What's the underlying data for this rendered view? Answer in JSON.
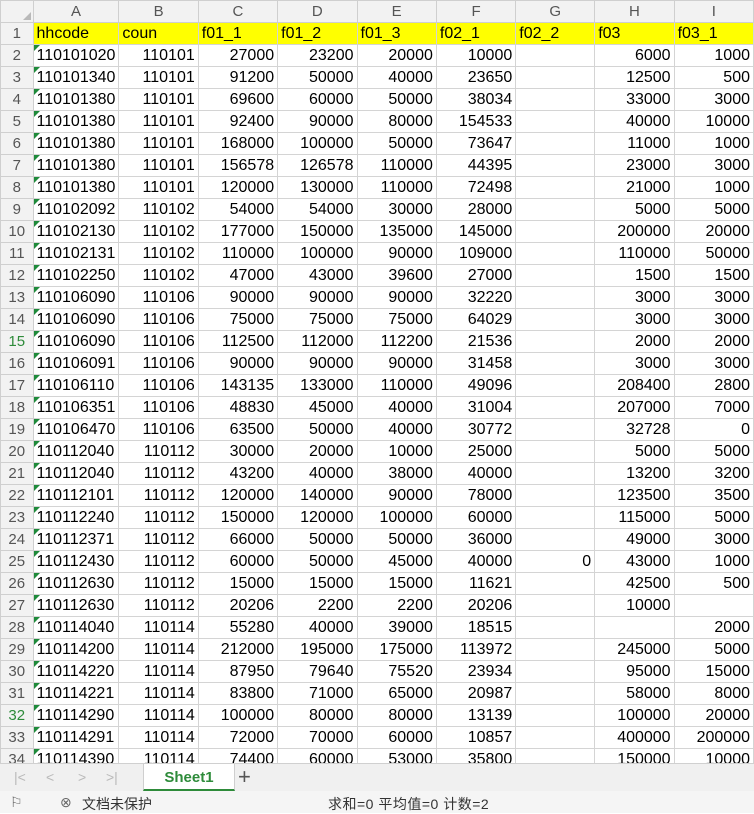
{
  "colors": {
    "header_fill": "#ffff00",
    "accent": "#2e8b3a",
    "grid": "#d4d4d4"
  },
  "columns": [
    "A",
    "B",
    "C",
    "D",
    "E",
    "F",
    "G",
    "H",
    "I"
  ],
  "selected_rows": [
    "15",
    "32"
  ],
  "header_row": {
    "num": "1",
    "cells": [
      "hhcode",
      "coun",
      "f01_1",
      "f01_2",
      "f01_3",
      "f02_1",
      "f02_2",
      "f03",
      "f03_1"
    ]
  },
  "rows": [
    {
      "num": "2",
      "cells": [
        "110101020",
        "110101",
        "27000",
        "23200",
        "20000",
        "10000",
        "",
        "6000",
        "1000"
      ]
    },
    {
      "num": "3",
      "cells": [
        "110101340",
        "110101",
        "91200",
        "50000",
        "40000",
        "23650",
        "",
        "12500",
        "500"
      ]
    },
    {
      "num": "4",
      "cells": [
        "110101380",
        "110101",
        "69600",
        "60000",
        "50000",
        "38034",
        "",
        "33000",
        "3000"
      ]
    },
    {
      "num": "5",
      "cells": [
        "110101380",
        "110101",
        "92400",
        "90000",
        "80000",
        "154533",
        "",
        "40000",
        "10000"
      ]
    },
    {
      "num": "6",
      "cells": [
        "110101380",
        "110101",
        "168000",
        "100000",
        "50000",
        "73647",
        "",
        "11000",
        "1000"
      ]
    },
    {
      "num": "7",
      "cells": [
        "110101380",
        "110101",
        "156578",
        "126578",
        "110000",
        "44395",
        "",
        "23000",
        "3000"
      ]
    },
    {
      "num": "8",
      "cells": [
        "110101380",
        "110101",
        "120000",
        "130000",
        "110000",
        "72498",
        "",
        "21000",
        "1000"
      ]
    },
    {
      "num": "9",
      "cells": [
        "110102092",
        "110102",
        "54000",
        "54000",
        "30000",
        "28000",
        "",
        "5000",
        "5000"
      ]
    },
    {
      "num": "10",
      "cells": [
        "110102130",
        "110102",
        "177000",
        "150000",
        "135000",
        "145000",
        "",
        "200000",
        "20000"
      ]
    },
    {
      "num": "11",
      "cells": [
        "110102131",
        "110102",
        "110000",
        "100000",
        "90000",
        "109000",
        "",
        "110000",
        "50000"
      ]
    },
    {
      "num": "12",
      "cells": [
        "110102250",
        "110102",
        "47000",
        "43000",
        "39600",
        "27000",
        "",
        "1500",
        "1500"
      ]
    },
    {
      "num": "13",
      "cells": [
        "110106090",
        "110106",
        "90000",
        "90000",
        "90000",
        "32220",
        "",
        "3000",
        "3000"
      ]
    },
    {
      "num": "14",
      "cells": [
        "110106090",
        "110106",
        "75000",
        "75000",
        "75000",
        "64029",
        "",
        "3000",
        "3000"
      ]
    },
    {
      "num": "15",
      "cells": [
        "110106090",
        "110106",
        "112500",
        "112000",
        "112200",
        "21536",
        "",
        "2000",
        "2000"
      ]
    },
    {
      "num": "16",
      "cells": [
        "110106091",
        "110106",
        "90000",
        "90000",
        "90000",
        "31458",
        "",
        "3000",
        "3000"
      ]
    },
    {
      "num": "17",
      "cells": [
        "110106110",
        "110106",
        "143135",
        "133000",
        "110000",
        "49096",
        "",
        "208400",
        "2800"
      ]
    },
    {
      "num": "18",
      "cells": [
        "110106351",
        "110106",
        "48830",
        "45000",
        "40000",
        "31004",
        "",
        "207000",
        "7000"
      ]
    },
    {
      "num": "19",
      "cells": [
        "110106470",
        "110106",
        "63500",
        "50000",
        "40000",
        "30772",
        "",
        "32728",
        "0"
      ]
    },
    {
      "num": "20",
      "cells": [
        "110112040",
        "110112",
        "30000",
        "20000",
        "10000",
        "25000",
        "",
        "5000",
        "5000"
      ]
    },
    {
      "num": "21",
      "cells": [
        "110112040",
        "110112",
        "43200",
        "40000",
        "38000",
        "40000",
        "",
        "13200",
        "3200"
      ]
    },
    {
      "num": "22",
      "cells": [
        "110112101",
        "110112",
        "120000",
        "140000",
        "90000",
        "78000",
        "",
        "123500",
        "3500"
      ]
    },
    {
      "num": "23",
      "cells": [
        "110112240",
        "110112",
        "150000",
        "120000",
        "100000",
        "60000",
        "",
        "115000",
        "5000"
      ]
    },
    {
      "num": "24",
      "cells": [
        "110112371",
        "110112",
        "66000",
        "50000",
        "50000",
        "36000",
        "",
        "49000",
        "3000"
      ]
    },
    {
      "num": "25",
      "cells": [
        "110112430",
        "110112",
        "60000",
        "50000",
        "45000",
        "40000",
        "0",
        "43000",
        "1000"
      ]
    },
    {
      "num": "26",
      "cells": [
        "110112630",
        "110112",
        "15000",
        "15000",
        "15000",
        "11621",
        "",
        "42500",
        "500"
      ]
    },
    {
      "num": "27",
      "cells": [
        "110112630",
        "110112",
        "20206",
        "2200",
        "2200",
        "20206",
        "",
        "10000",
        ""
      ]
    },
    {
      "num": "28",
      "cells": [
        "110114040",
        "110114",
        "55280",
        "40000",
        "39000",
        "18515",
        "",
        "",
        "2000"
      ]
    },
    {
      "num": "29",
      "cells": [
        "110114200",
        "110114",
        "212000",
        "195000",
        "175000",
        "113972",
        "",
        "245000",
        "5000"
      ]
    },
    {
      "num": "30",
      "cells": [
        "110114220",
        "110114",
        "87950",
        "79640",
        "75520",
        "23934",
        "",
        "95000",
        "15000"
      ]
    },
    {
      "num": "31",
      "cells": [
        "110114221",
        "110114",
        "83800",
        "71000",
        "65000",
        "20987",
        "",
        "58000",
        "8000"
      ]
    },
    {
      "num": "32",
      "cells": [
        "110114290",
        "110114",
        "100000",
        "80000",
        "80000",
        "13139",
        "",
        "100000",
        "20000"
      ]
    },
    {
      "num": "33",
      "cells": [
        "110114291",
        "110114",
        "72000",
        "70000",
        "60000",
        "10857",
        "",
        "400000",
        "200000"
      ]
    },
    {
      "num": "34",
      "cells": [
        "110114390",
        "110114",
        "74400",
        "60000",
        "53000",
        "35800",
        "",
        "150000",
        "10000"
      ]
    }
  ],
  "tabs": {
    "sheet_name": "Sheet1",
    "add_label": "+"
  },
  "nav_icons": [
    "first-sheet-icon",
    "prev-sheet-icon",
    "next-sheet-icon",
    "last-sheet-icon"
  ],
  "status": {
    "protect_label": "文档未保护",
    "summary": "求和=0  平均值=0  计数=2"
  }
}
